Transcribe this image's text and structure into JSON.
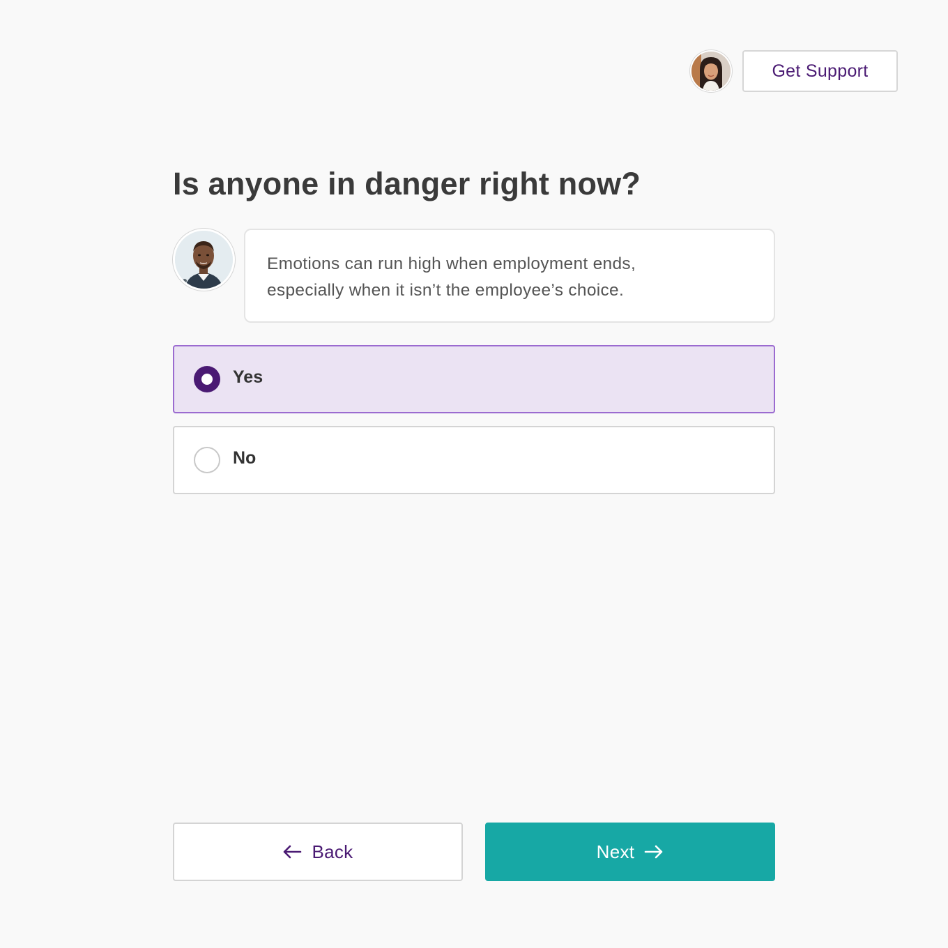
{
  "header": {
    "support_button_label": "Get Support"
  },
  "question": {
    "title": "Is anyone in danger right now?",
    "message_line1": "Emotions can run high when employment ends,",
    "message_line2": "especially when it isn’t the employee’s choice."
  },
  "options": [
    {
      "label": "Yes",
      "selected": true
    },
    {
      "label": "No",
      "selected": false
    }
  ],
  "navigation": {
    "back_label": "Back",
    "next_label": "Next"
  },
  "colors": {
    "brand_purple": "#4a1a73",
    "selected_bg": "#ebe3f3",
    "selected_border": "#9b6bd0",
    "next_teal": "#17a8a5"
  },
  "icons": {
    "back": "arrow-left-icon",
    "next": "arrow-right-icon"
  }
}
